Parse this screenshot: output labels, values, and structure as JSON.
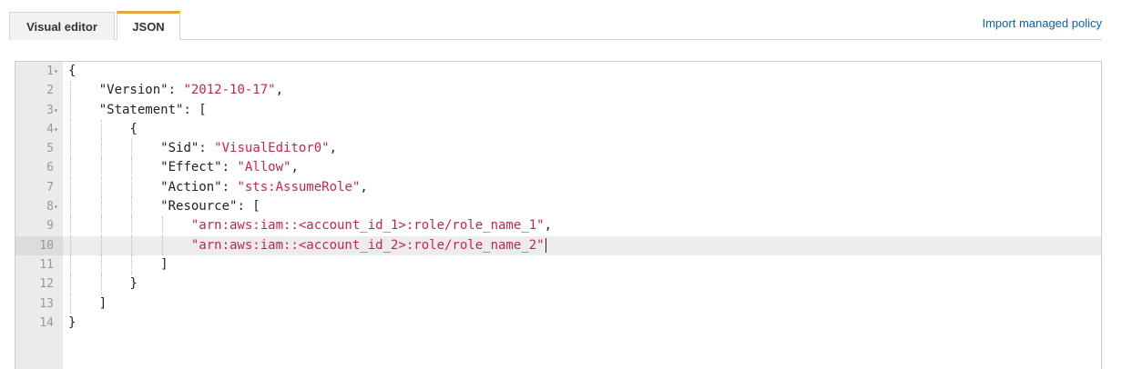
{
  "tabs": [
    {
      "label": "Visual editor",
      "active": false
    },
    {
      "label": "JSON",
      "active": true
    }
  ],
  "import_link": "Import managed policy",
  "colors": {
    "accent_tab": "#e8a33a",
    "link": "#0a5fb4",
    "string": "#c7254e"
  },
  "editor": {
    "active_line": 10,
    "lines": [
      {
        "n": "1",
        "fold": true,
        "indent": 0,
        "parts": [
          {
            "t": "{"
          }
        ]
      },
      {
        "n": "2",
        "fold": false,
        "indent": 1,
        "parts": [
          {
            "t": "\"Version\": "
          },
          {
            "t": "\"2012-10-17\"",
            "s": true
          },
          {
            "t": ","
          }
        ]
      },
      {
        "n": "3",
        "fold": true,
        "indent": 1,
        "parts": [
          {
            "t": "\"Statement\": ["
          }
        ]
      },
      {
        "n": "4",
        "fold": true,
        "indent": 2,
        "parts": [
          {
            "t": "{"
          }
        ]
      },
      {
        "n": "5",
        "fold": false,
        "indent": 3,
        "parts": [
          {
            "t": "\"Sid\": "
          },
          {
            "t": "\"VisualEditor0\"",
            "s": true
          },
          {
            "t": ","
          }
        ]
      },
      {
        "n": "6",
        "fold": false,
        "indent": 3,
        "parts": [
          {
            "t": "\"Effect\": "
          },
          {
            "t": "\"Allow\"",
            "s": true
          },
          {
            "t": ","
          }
        ]
      },
      {
        "n": "7",
        "fold": false,
        "indent": 3,
        "parts": [
          {
            "t": "\"Action\": "
          },
          {
            "t": "\"sts:AssumeRole\"",
            "s": true
          },
          {
            "t": ","
          }
        ]
      },
      {
        "n": "8",
        "fold": true,
        "indent": 3,
        "parts": [
          {
            "t": "\"Resource\": ["
          }
        ]
      },
      {
        "n": "9",
        "fold": false,
        "indent": 4,
        "parts": [
          {
            "t": "\"arn:aws:iam::<account_id_1>:role/role_name_1\"",
            "s": true
          },
          {
            "t": ","
          }
        ]
      },
      {
        "n": "10",
        "fold": false,
        "indent": 4,
        "parts": [
          {
            "t": "\"arn:aws:iam::<account_id_2>:role/role_name_2\"",
            "s": true
          }
        ],
        "cursor": true
      },
      {
        "n": "11",
        "fold": false,
        "indent": 3,
        "parts": [
          {
            "t": "]"
          }
        ]
      },
      {
        "n": "12",
        "fold": false,
        "indent": 2,
        "parts": [
          {
            "t": "}"
          }
        ]
      },
      {
        "n": "13",
        "fold": false,
        "indent": 1,
        "parts": [
          {
            "t": "]"
          }
        ]
      },
      {
        "n": "14",
        "fold": false,
        "indent": 0,
        "parts": [
          {
            "t": "}"
          }
        ]
      }
    ]
  }
}
